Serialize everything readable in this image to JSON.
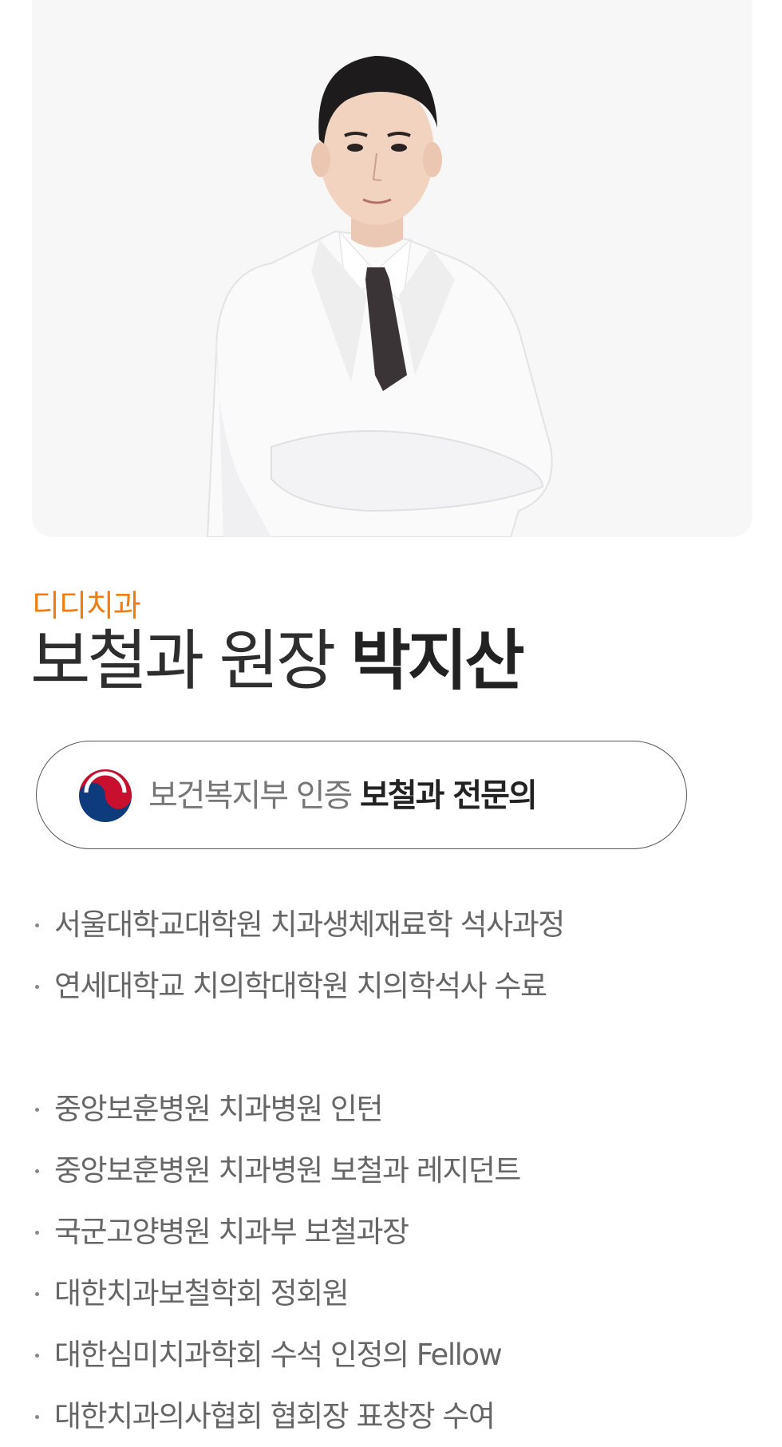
{
  "clinic_name": "디디치과",
  "title": {
    "prefix": "보철과 원장 ",
    "name": "박지산"
  },
  "certification": {
    "light_text": "보건복지부 인증 ",
    "strong_text": "보철과 전문의",
    "emblem_icon": "korea-government-emblem-icon"
  },
  "education": [
    "서울대학교대학원 치과생체재료학 석사과정",
    "연세대학교 치의학대학원 치의학석사 수료"
  ],
  "career": [
    "중앙보훈병원 치과병원 인턴",
    "중앙보훈병원 치과병원 보철과 레지던트",
    "국군고양병원 치과부 보철과장",
    "대한치과보철학회 정회원",
    "대한심미치과학회 수석 인정의 Fellow",
    "대한치과의사협회 협회장 표창장 수여"
  ],
  "colors": {
    "accent": "#ef7d10",
    "photo_bg": "#f7f7f8"
  }
}
